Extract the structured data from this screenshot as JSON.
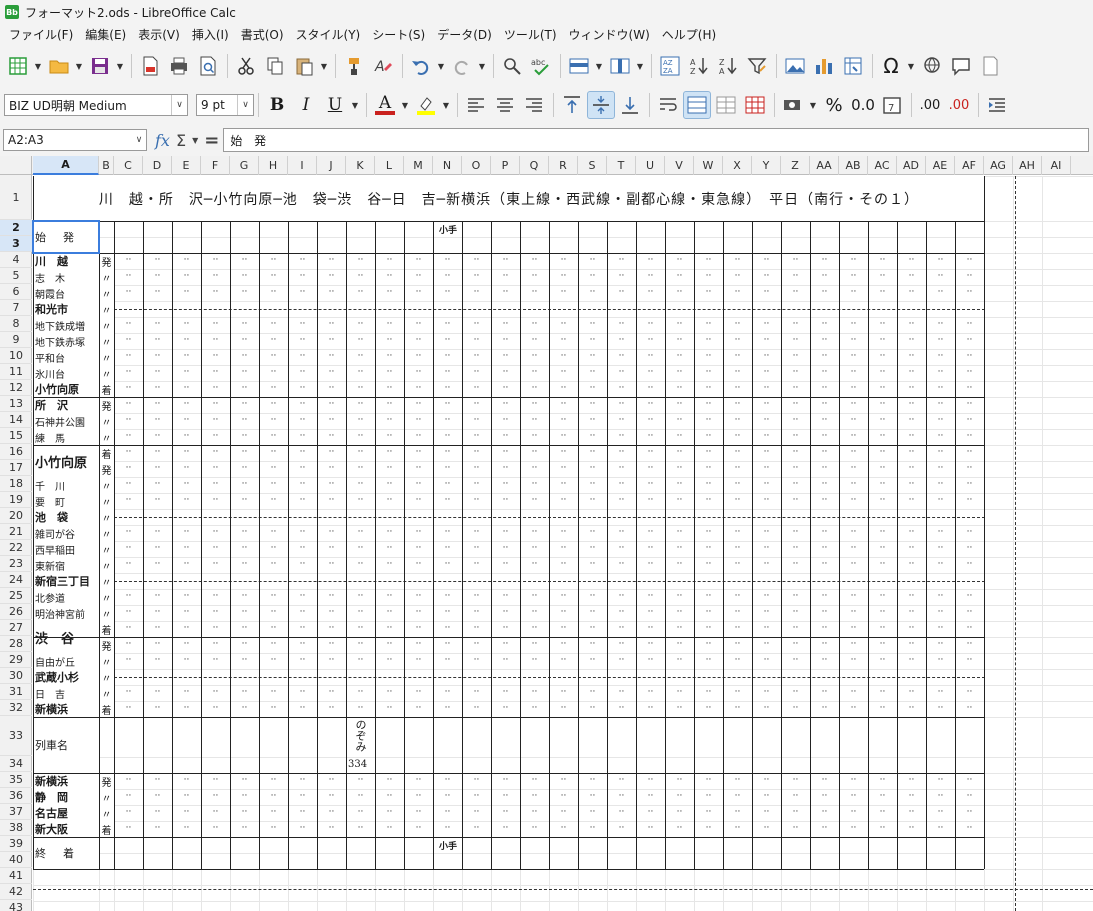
{
  "window": {
    "title": "フォーマット2.ods - LibreOffice Calc"
  },
  "menu": [
    "ファイル(F)",
    "編集(E)",
    "表示(V)",
    "挿入(I)",
    "書式(O)",
    "スタイル(Y)",
    "シート(S)",
    "データ(D)",
    "ツール(T)",
    "ウィンドウ(W)",
    "ヘルプ(H)"
  ],
  "format_bar": {
    "font_name": "BIZ UD明朝 Medium",
    "font_size": "9 pt",
    "bold": "B",
    "italic": "I",
    "underline": "U",
    "font_color": "A",
    "percent": "%",
    "number": "0.0",
    "dec_add": ".00",
    "dec_del": ".00"
  },
  "formula_bar": {
    "name_box": "A2:A3",
    "content": "始 発"
  },
  "columns": [
    "A",
    "B",
    "C",
    "D",
    "E",
    "F",
    "G",
    "H",
    "I",
    "J",
    "K",
    "L",
    "M",
    "N",
    "O",
    "P",
    "Q",
    "R",
    "S",
    "T",
    "U",
    "V",
    "W",
    "X",
    "Y",
    "Z",
    "AA",
    "AB",
    "AC",
    "AD",
    "AE",
    "AF",
    "AG",
    "AH",
    "AI"
  ],
  "rows": [
    "1",
    "2",
    "3",
    "4",
    "5",
    "6",
    "7",
    "8",
    "9",
    "10",
    "11",
    "12",
    "13",
    "14",
    "15",
    "16",
    "17",
    "18",
    "19",
    "20",
    "21",
    "22",
    "23",
    "24",
    "25",
    "26",
    "27",
    "28",
    "29",
    "30",
    "31",
    "32",
    "33",
    "34",
    "35",
    "36",
    "37",
    "38",
    "39",
    "40",
    "41",
    "42",
    "43"
  ],
  "sheet": {
    "title": "川　越・所　沢─小竹向原─池　袋─渋　谷─日　吉─新横浜（東上線・西武線・副都心線・東急線）　平日（南行・その１）",
    "first_departure": "始　発",
    "kote_top": "小手",
    "kote_bottom": "小手",
    "train_name_label": "列車名",
    "train_name": "のぞみ",
    "train_number": "334",
    "final_arrival": "終　着",
    "dot": "··",
    "stations": [
      {
        "name": "川　越",
        "mark": "発",
        "bold": true
      },
      {
        "name": "志　木",
        "mark": "〃",
        "bold": false
      },
      {
        "name": "朝霞台",
        "mark": "〃",
        "bold": false
      },
      {
        "name": "和光市",
        "mark": "〃",
        "bold": true
      },
      {
        "name": "地下鉄成増",
        "mark": "〃",
        "bold": false
      },
      {
        "name": "地下鉄赤塚",
        "mark": "〃",
        "bold": false
      },
      {
        "name": "平和台",
        "mark": "〃",
        "bold": false
      },
      {
        "name": "氷川台",
        "mark": "〃",
        "bold": false
      },
      {
        "name": "小竹向原",
        "mark": "着",
        "bold": true
      },
      {
        "name": "所　沢",
        "mark": "発",
        "bold": true
      },
      {
        "name": "石神井公園",
        "mark": "〃",
        "bold": false
      },
      {
        "name": "練　馬",
        "mark": "〃",
        "bold": false
      },
      {
        "name": "小竹向原",
        "mark": "着",
        "bold": true
      },
      {
        "name": "",
        "mark": "発",
        "bold": false
      },
      {
        "name": "千　川",
        "mark": "〃",
        "bold": false
      },
      {
        "name": "要　町",
        "mark": "〃",
        "bold": false
      },
      {
        "name": "池　袋",
        "mark": "〃",
        "bold": true
      },
      {
        "name": "雑司が谷",
        "mark": "〃",
        "bold": false
      },
      {
        "name": "西早稲田",
        "mark": "〃",
        "bold": false
      },
      {
        "name": "東新宿",
        "mark": "〃",
        "bold": false
      },
      {
        "name": "新宿三丁目",
        "mark": "〃",
        "bold": true
      },
      {
        "name": "北参道",
        "mark": "〃",
        "bold": false
      },
      {
        "name": "明治神宮前",
        "mark": "〃",
        "bold": false
      },
      {
        "name": "渋　谷",
        "mark": "着",
        "bold": true
      },
      {
        "name": "",
        "mark": "発",
        "bold": false
      },
      {
        "name": "自由が丘",
        "mark": "〃",
        "bold": false
      },
      {
        "name": "武蔵小杉",
        "mark": "〃",
        "bold": true
      },
      {
        "name": "日　吉",
        "mark": "〃",
        "bold": false
      },
      {
        "name": "新横浜",
        "mark": "着",
        "bold": true
      }
    ],
    "shinkansen": [
      {
        "name": "新横浜",
        "mark": "発"
      },
      {
        "name": "静　岡",
        "mark": "〃"
      },
      {
        "name": "名古屋",
        "mark": "〃"
      },
      {
        "name": "新大阪",
        "mark": "着"
      }
    ]
  }
}
